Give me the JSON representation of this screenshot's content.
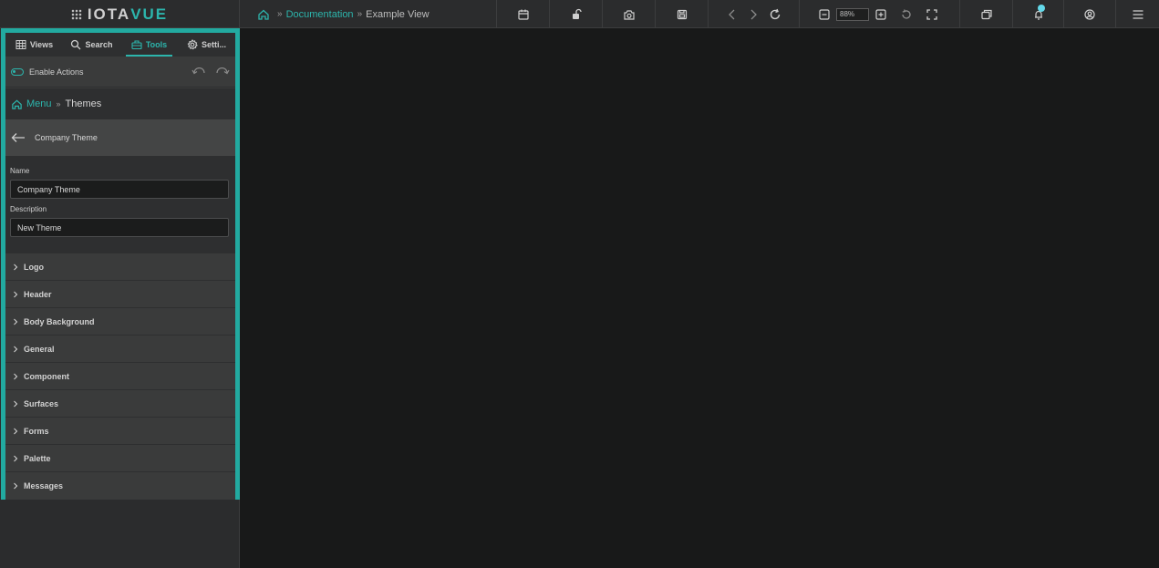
{
  "app": {
    "logo_part1": "IOTA",
    "logo_part2": "VUE"
  },
  "breadcrumb": {
    "documentation": "Documentation",
    "example_view": "Example View"
  },
  "toolbar": {
    "zoom_value": "88%",
    "notification_count": ""
  },
  "panel": {
    "tabs": [
      {
        "label": "Views",
        "icon": "grid-icon"
      },
      {
        "label": "Search",
        "icon": "search-icon"
      },
      {
        "label": "Tools",
        "icon": "toolbox-icon"
      },
      {
        "label": "Setti...",
        "icon": "gear-icon"
      }
    ],
    "enable_actions_label": "Enable Actions",
    "menu_crumb": {
      "menu": "Menu",
      "themes": "Themes"
    },
    "back_title": "Company Theme",
    "form": {
      "name_label": "Name",
      "name_value": "Company Theme",
      "description_label": "Description",
      "description_value": "New Theme"
    },
    "sections": [
      "Logo",
      "Header",
      "Body Background",
      "General",
      "Component",
      "Surfaces",
      "Forms",
      "Palette",
      "Messages"
    ]
  },
  "colors": {
    "accent": "#2cb5ac",
    "panel_border": "#22aaa0",
    "background": "#181919",
    "toolbar": "#2b2c2d"
  }
}
